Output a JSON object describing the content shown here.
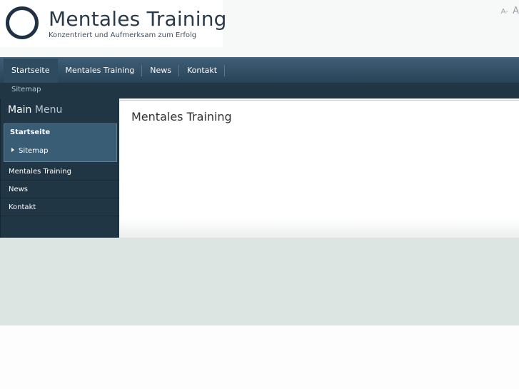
{
  "logo": {
    "title": "Mentales Training",
    "subtitle": "Konzentriert und Aufmerksam zum Erfolg"
  },
  "font_size_controls": {
    "smaller": "A-",
    "larger": "A"
  },
  "nav": {
    "items": [
      {
        "label": "Startseite",
        "active": true
      },
      {
        "label": "Mentales Training"
      },
      {
        "label": "News"
      },
      {
        "label": "Kontakt"
      }
    ]
  },
  "subnav": {
    "link": "Sitemap"
  },
  "sidebar": {
    "title_main": "Main",
    "title_rest": "Menu",
    "active_item": "Startseite",
    "sub_item": "Sitemap",
    "items": [
      {
        "label": "Mentales Training"
      },
      {
        "label": "News"
      },
      {
        "label": "Kontakt"
      }
    ]
  },
  "content": {
    "title": "Mentales Training"
  },
  "colors": {
    "nav_bar": "#2f4c62",
    "sidebar_bg": "#213645",
    "active_block": "#3a5d76",
    "footer_band": "#dde5e3"
  }
}
